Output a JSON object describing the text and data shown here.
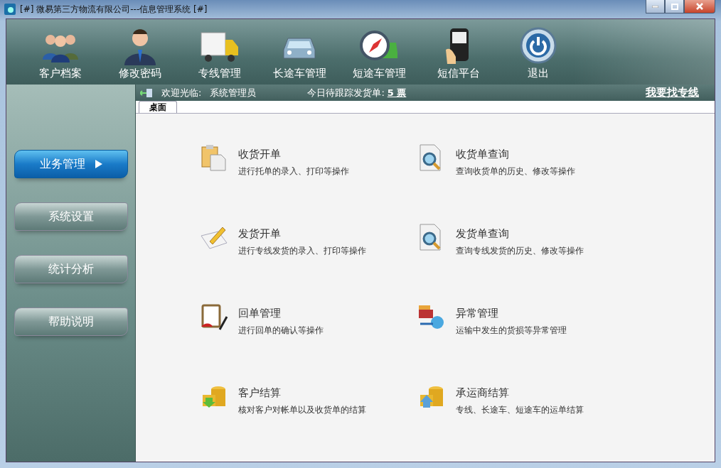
{
  "window": {
    "title": "[#] 微易第三方物流有限公司---信息管理系统 [#]"
  },
  "toolbar": [
    {
      "label": "客户档案",
      "kind": "people"
    },
    {
      "label": "修改密码",
      "kind": "person"
    },
    {
      "label": "专线管理",
      "kind": "truck"
    },
    {
      "label": "长途车管理",
      "kind": "car"
    },
    {
      "label": "短途车管理",
      "kind": "compass"
    },
    {
      "label": "短信平台",
      "kind": "phone"
    },
    {
      "label": "退出",
      "kind": "power"
    }
  ],
  "sidebar": {
    "items": [
      {
        "label": "业务管理",
        "selected": true
      },
      {
        "label": "系统设置",
        "selected": false
      },
      {
        "label": "统计分析",
        "selected": false
      },
      {
        "label": "帮助说明",
        "selected": false
      }
    ]
  },
  "info_bar": {
    "welcome_label": "欢迎光临:",
    "user": "系统管理员",
    "pending_label": "今日待跟踪发货单:",
    "pending_count": "5 票",
    "link": "我要找专线"
  },
  "tabs": [
    {
      "label": "桌面",
      "selected": true
    }
  ],
  "desktop": [
    {
      "title": "收货开单",
      "description": "进行托单的录入、打印等操作",
      "kind": "clipboard"
    },
    {
      "title": "收货单查询",
      "description": "查询收货单的历史、修改等操作",
      "kind": "search"
    },
    {
      "title": "发货开单",
      "description": "进行专线发货的录入、打印等操作",
      "kind": "pencil"
    },
    {
      "title": "发货单查询",
      "description": "查询专线发货的历史、修改等操作",
      "kind": "search"
    },
    {
      "title": "回单管理",
      "description": "进行回单的确认等操作",
      "kind": "receipt"
    },
    {
      "title": "异常管理",
      "description": "运输中发生的货损等异常管理",
      "kind": "exception"
    },
    {
      "title": "客户结算",
      "description": "核对客户对帐单以及收货单的结算",
      "kind": "coins-down"
    },
    {
      "title": "承运商结算",
      "description": "专线、长途车、短途车的运单结算",
      "kind": "coins-up"
    }
  ]
}
